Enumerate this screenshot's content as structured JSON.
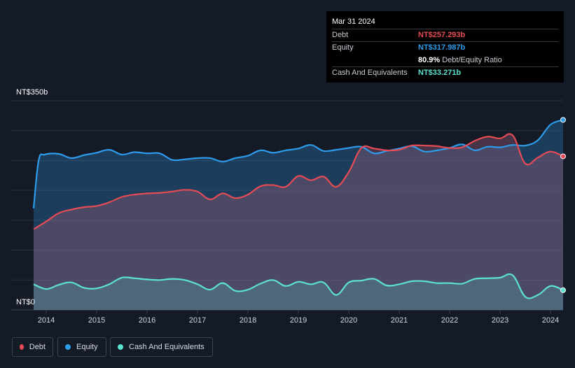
{
  "tooltip": {
    "date": "Mar 31 2024",
    "rows": [
      {
        "name": "Debt",
        "value": "NT$257.293b",
        "color": "#e64b55"
      },
      {
        "name": "Equity",
        "value": "NT$317.987b",
        "color": "#2e9bea"
      },
      {
        "name": "",
        "value": "80.9%",
        "suffix": "Debt/Equity Ratio",
        "color": "#ffffff"
      },
      {
        "name": "Cash And Equivalents",
        "value": "NT$33.271b",
        "color": "#5ce1d0"
      }
    ]
  },
  "legend": [
    {
      "label": "Debt",
      "color": "#e64b55"
    },
    {
      "label": "Equity",
      "color": "#2e9bea"
    },
    {
      "label": "Cash And Equivalents",
      "color": "#5ce1d0"
    }
  ],
  "chart_data": {
    "type": "area",
    "y_top_label": "NT$350b",
    "y_bottom_label": "NT$0",
    "ylim": [
      0,
      350
    ],
    "xlim": [
      2013.75,
      2024.25
    ],
    "x_ticks": [
      2014,
      2015,
      2016,
      2017,
      2018,
      2019,
      2020,
      2021,
      2022,
      2023,
      2024
    ],
    "grid": true,
    "series": [
      {
        "name": "Equity",
        "color": "#2e9bea",
        "points": [
          [
            2013.75,
            170
          ],
          [
            2013.85,
            250
          ],
          [
            2013.97,
            260
          ],
          [
            2014.25,
            261
          ],
          [
            2014.5,
            254
          ],
          [
            2014.75,
            259
          ],
          [
            2015.0,
            263
          ],
          [
            2015.25,
            268
          ],
          [
            2015.5,
            260
          ],
          [
            2015.75,
            264
          ],
          [
            2016.0,
            262
          ],
          [
            2016.25,
            262
          ],
          [
            2016.5,
            251
          ],
          [
            2016.75,
            252
          ],
          [
            2017.0,
            254
          ],
          [
            2017.25,
            254
          ],
          [
            2017.5,
            248
          ],
          [
            2017.75,
            254
          ],
          [
            2018.0,
            258
          ],
          [
            2018.25,
            267
          ],
          [
            2018.5,
            263
          ],
          [
            2018.75,
            267
          ],
          [
            2019.0,
            270
          ],
          [
            2019.25,
            276
          ],
          [
            2019.5,
            266
          ],
          [
            2019.75,
            268
          ],
          [
            2020.0,
            271
          ],
          [
            2020.25,
            273
          ],
          [
            2020.5,
            262
          ],
          [
            2020.75,
            266
          ],
          [
            2021.0,
            270
          ],
          [
            2021.25,
            274
          ],
          [
            2021.5,
            265
          ],
          [
            2021.75,
            267
          ],
          [
            2022.0,
            271
          ],
          [
            2022.25,
            277
          ],
          [
            2022.5,
            267
          ],
          [
            2022.75,
            273
          ],
          [
            2023.0,
            272
          ],
          [
            2023.25,
            276
          ],
          [
            2023.5,
            275
          ],
          [
            2023.75,
            284
          ],
          [
            2024.0,
            310
          ],
          [
            2024.25,
            318
          ]
        ]
      },
      {
        "name": "Debt",
        "color": "#e64b55",
        "points": [
          [
            2013.75,
            135
          ],
          [
            2014.0,
            148
          ],
          [
            2014.25,
            162
          ],
          [
            2014.5,
            168
          ],
          [
            2014.75,
            172
          ],
          [
            2015.0,
            174
          ],
          [
            2015.25,
            180
          ],
          [
            2015.5,
            189
          ],
          [
            2015.75,
            193
          ],
          [
            2016.0,
            195
          ],
          [
            2016.25,
            196
          ],
          [
            2016.5,
            198
          ],
          [
            2016.75,
            201
          ],
          [
            2017.0,
            198
          ],
          [
            2017.25,
            185
          ],
          [
            2017.5,
            195
          ],
          [
            2017.75,
            187
          ],
          [
            2018.0,
            193
          ],
          [
            2018.25,
            207
          ],
          [
            2018.5,
            209
          ],
          [
            2018.75,
            206
          ],
          [
            2019.0,
            224
          ],
          [
            2019.25,
            217
          ],
          [
            2019.5,
            223
          ],
          [
            2019.75,
            206
          ],
          [
            2020.0,
            231
          ],
          [
            2020.25,
            271
          ],
          [
            2020.5,
            270
          ],
          [
            2020.75,
            267
          ],
          [
            2021.0,
            268
          ],
          [
            2021.25,
            275
          ],
          [
            2021.5,
            275
          ],
          [
            2021.75,
            274
          ],
          [
            2022.0,
            271
          ],
          [
            2022.25,
            272
          ],
          [
            2022.5,
            283
          ],
          [
            2022.75,
            290
          ],
          [
            2023.0,
            287
          ],
          [
            2023.25,
            292
          ],
          [
            2023.5,
            245
          ],
          [
            2023.75,
            255
          ],
          [
            2024.0,
            265
          ],
          [
            2024.25,
            257
          ]
        ]
      },
      {
        "name": "Cash And Equivalents",
        "color": "#5ce1d0",
        "points": [
          [
            2013.75,
            43
          ],
          [
            2014.0,
            35
          ],
          [
            2014.25,
            42
          ],
          [
            2014.5,
            46
          ],
          [
            2014.75,
            37
          ],
          [
            2015.0,
            36
          ],
          [
            2015.25,
            43
          ],
          [
            2015.5,
            54
          ],
          [
            2015.75,
            53
          ],
          [
            2016.0,
            51
          ],
          [
            2016.25,
            50
          ],
          [
            2016.5,
            52
          ],
          [
            2016.75,
            50
          ],
          [
            2017.0,
            43
          ],
          [
            2017.25,
            34
          ],
          [
            2017.5,
            45
          ],
          [
            2017.75,
            32
          ],
          [
            2018.0,
            34
          ],
          [
            2018.25,
            44
          ],
          [
            2018.5,
            50
          ],
          [
            2018.75,
            40
          ],
          [
            2019.0,
            47
          ],
          [
            2019.25,
            43
          ],
          [
            2019.5,
            46
          ],
          [
            2019.75,
            25
          ],
          [
            2020.0,
            46
          ],
          [
            2020.25,
            49
          ],
          [
            2020.5,
            52
          ],
          [
            2020.75,
            41
          ],
          [
            2021.0,
            43
          ],
          [
            2021.25,
            48
          ],
          [
            2021.5,
            48
          ],
          [
            2021.75,
            45
          ],
          [
            2022.0,
            45
          ],
          [
            2022.25,
            44
          ],
          [
            2022.5,
            52
          ],
          [
            2022.75,
            53
          ],
          [
            2023.0,
            54
          ],
          [
            2023.25,
            58
          ],
          [
            2023.5,
            22
          ],
          [
            2023.75,
            25
          ],
          [
            2024.0,
            40
          ],
          [
            2024.25,
            33
          ]
        ]
      }
    ]
  }
}
